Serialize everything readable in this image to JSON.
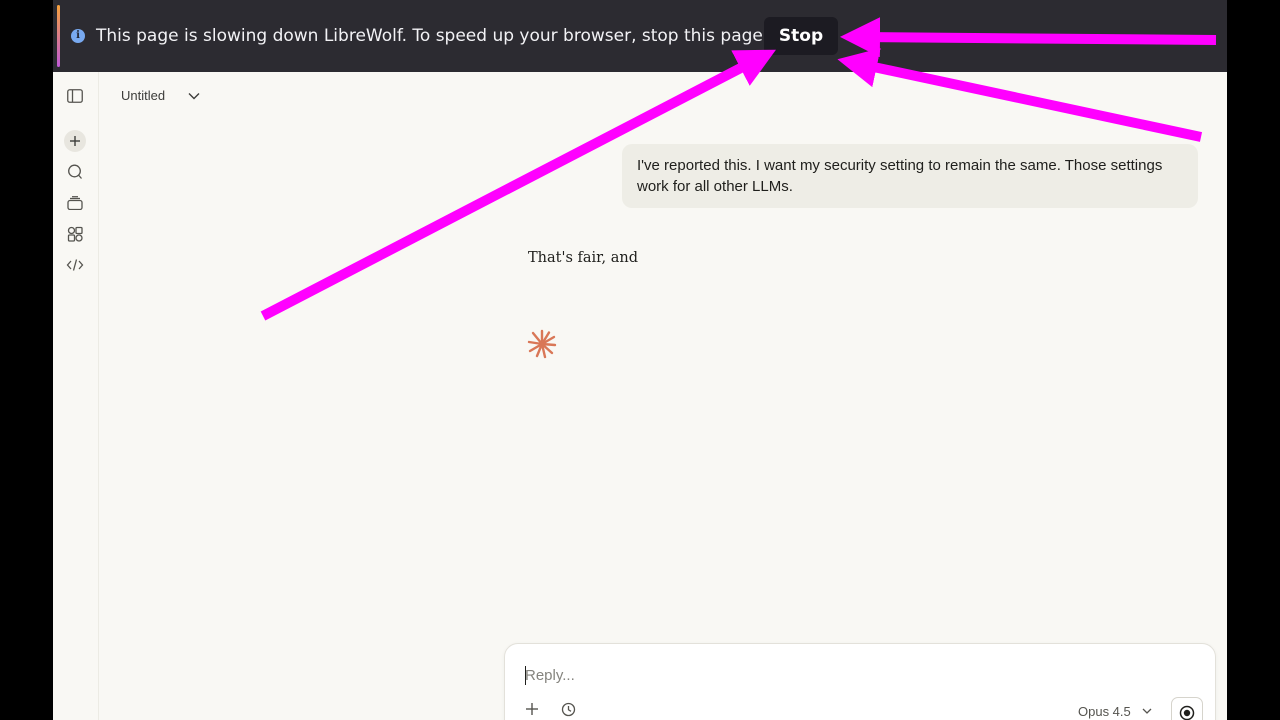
{
  "notification": {
    "info_icon": "info-icon",
    "message": "This page is slowing down LibreWolf. To speed up your browser, stop this page.",
    "stop_label": "Stop"
  },
  "rail": {
    "icons": [
      "sidebar-toggle-icon",
      "plus-icon",
      "chat-bubble-icon",
      "projects-icon",
      "artifacts-icon",
      "code-icon"
    ]
  },
  "header": {
    "title": "Untitled"
  },
  "conversation": {
    "user_message": "I've reported this. I want my security setting to remain the same. Those settings work for all other LLMs.",
    "assistant_partial": "That's fair, and"
  },
  "composer": {
    "placeholder": "Reply...",
    "model": "Opus 4.5"
  },
  "colors": {
    "accent_magenta": "#ff00ff",
    "spinner": "#d97757",
    "notification_bg": "#2c2b31"
  }
}
